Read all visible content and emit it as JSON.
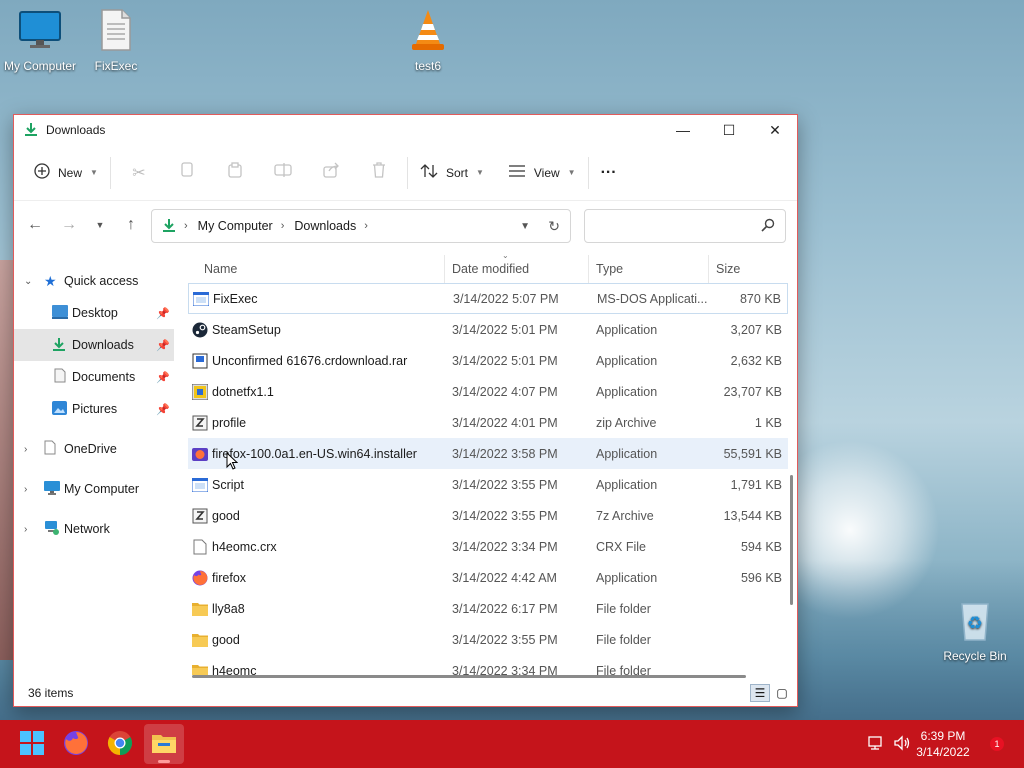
{
  "desktop": {
    "icons": [
      {
        "label": "My Computer"
      },
      {
        "label": "FixExec"
      },
      {
        "label": "test6"
      },
      {
        "label": "Recycle Bin"
      }
    ]
  },
  "window": {
    "title": "Downloads",
    "controls": {
      "minimize": "—",
      "maximize": "☐",
      "close": "✕"
    },
    "toolbar": {
      "new_label": "New",
      "sort_label": "Sort",
      "view_label": "View",
      "more_label": "···"
    },
    "address": {
      "crumbs": [
        "My Computer",
        "Downloads"
      ],
      "search_placeholder": ""
    },
    "sidebar": {
      "items": [
        {
          "label": "Quick access"
        },
        {
          "label": "Desktop"
        },
        {
          "label": "Downloads"
        },
        {
          "label": "Documents"
        },
        {
          "label": "Pictures"
        },
        {
          "label": "OneDrive"
        },
        {
          "label": "My Computer"
        },
        {
          "label": "Network"
        }
      ]
    },
    "columns": {
      "name": "Name",
      "date": "Date modified",
      "type": "Type",
      "size": "Size"
    },
    "files": [
      {
        "name": "FixExec",
        "date": "3/14/2022 5:07 PM",
        "type": "MS-DOS Applicati...",
        "size": "870 KB"
      },
      {
        "name": "SteamSetup",
        "date": "3/14/2022 5:01 PM",
        "type": "Application",
        "size": "3,207 KB"
      },
      {
        "name": "Unconfirmed 61676.crdownload.rar",
        "date": "3/14/2022 5:01 PM",
        "type": "Application",
        "size": "2,632 KB"
      },
      {
        "name": "dotnetfx1.1",
        "date": "3/14/2022 4:07 PM",
        "type": "Application",
        "size": "23,707 KB"
      },
      {
        "name": "profile",
        "date": "3/14/2022 4:01 PM",
        "type": "zip Archive",
        "size": "1 KB"
      },
      {
        "name": "firefox-100.0a1.en-US.win64.installer",
        "date": "3/14/2022 3:58 PM",
        "type": "Application",
        "size": "55,591 KB"
      },
      {
        "name": "Script",
        "date": "3/14/2022 3:55 PM",
        "type": "Application",
        "size": "1,791 KB"
      },
      {
        "name": "good",
        "date": "3/14/2022 3:55 PM",
        "type": "7z Archive",
        "size": "13,544 KB"
      },
      {
        "name": "h4eomc.crx",
        "date": "3/14/2022 3:34 PM",
        "type": "CRX File",
        "size": "594 KB"
      },
      {
        "name": "firefox",
        "date": "3/14/2022 4:42 AM",
        "type": "Application",
        "size": "596 KB"
      },
      {
        "name": "lly8a8",
        "date": "3/14/2022 6:17 PM",
        "type": "File folder",
        "size": ""
      },
      {
        "name": "good",
        "date": "3/14/2022 3:55 PM",
        "type": "File folder",
        "size": ""
      },
      {
        "name": "h4eomc",
        "date": "3/14/2022 3:34 PM",
        "type": "File folder",
        "size": ""
      }
    ],
    "status": {
      "item_count": "36 items"
    }
  },
  "taskbar": {
    "clock_time": "6:39 PM",
    "clock_date": "3/14/2022",
    "notification_count": "1"
  },
  "colors": {
    "taskbar": "#c5141b",
    "window_border": "#e25b5b",
    "selection": "#e8f0fa",
    "folder": "#f2c24f"
  }
}
